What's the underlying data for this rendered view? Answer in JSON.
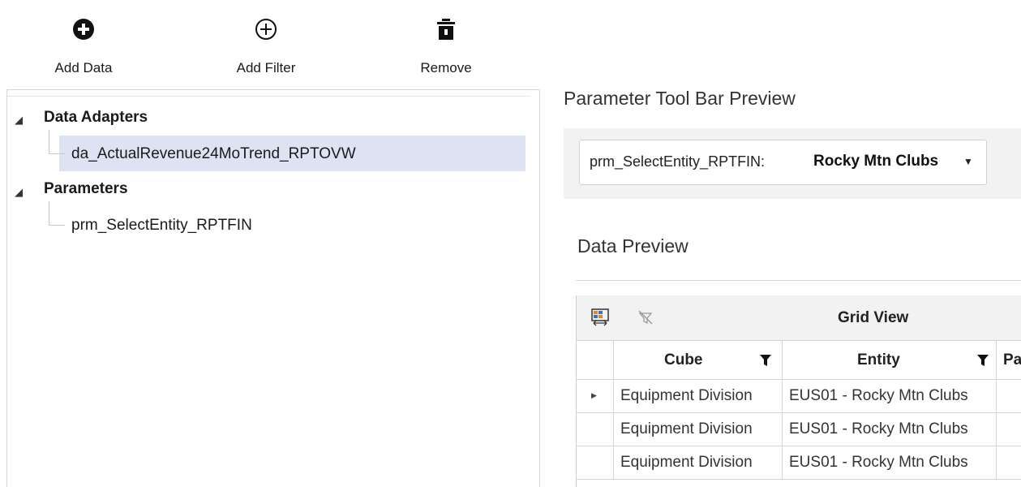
{
  "toolbar": {
    "add_data": {
      "label": "Add Data",
      "icon": "plus-circle-filled-icon"
    },
    "add_filter": {
      "label": "Add Filter",
      "icon": "plus-circle-outline-icon"
    },
    "remove": {
      "label": "Remove",
      "icon": "trash-icon"
    }
  },
  "tree": {
    "groups": [
      {
        "label": "Data Adapters",
        "children": [
          "da_ActualRevenue24MoTrend_RPTOVW"
        ]
      },
      {
        "label": "Parameters",
        "children": [
          "prm_SelectEntity_RPTFIN"
        ]
      }
    ]
  },
  "parameter_toolbar": {
    "title": "Parameter Tool Bar Preview",
    "param_name": "prm_SelectEntity_RPTFIN:",
    "param_value": "Rocky Mtn Clubs"
  },
  "data_preview": {
    "title": "Data Preview",
    "grid_title": "Grid View",
    "columns": [
      "Cube",
      "Entity",
      "Pa"
    ],
    "rows": [
      [
        "Equipment Division",
        "EUS01 - Rocky Mtn Clubs"
      ],
      [
        "Equipment Division",
        "EUS01 - Rocky Mtn Clubs"
      ],
      [
        "Equipment Division",
        "EUS01 - Rocky Mtn Clubs"
      ]
    ]
  },
  "colors": {
    "selection": "#dde3f3",
    "header_bg": "#f2f2f2",
    "border": "#d4d4d4"
  }
}
